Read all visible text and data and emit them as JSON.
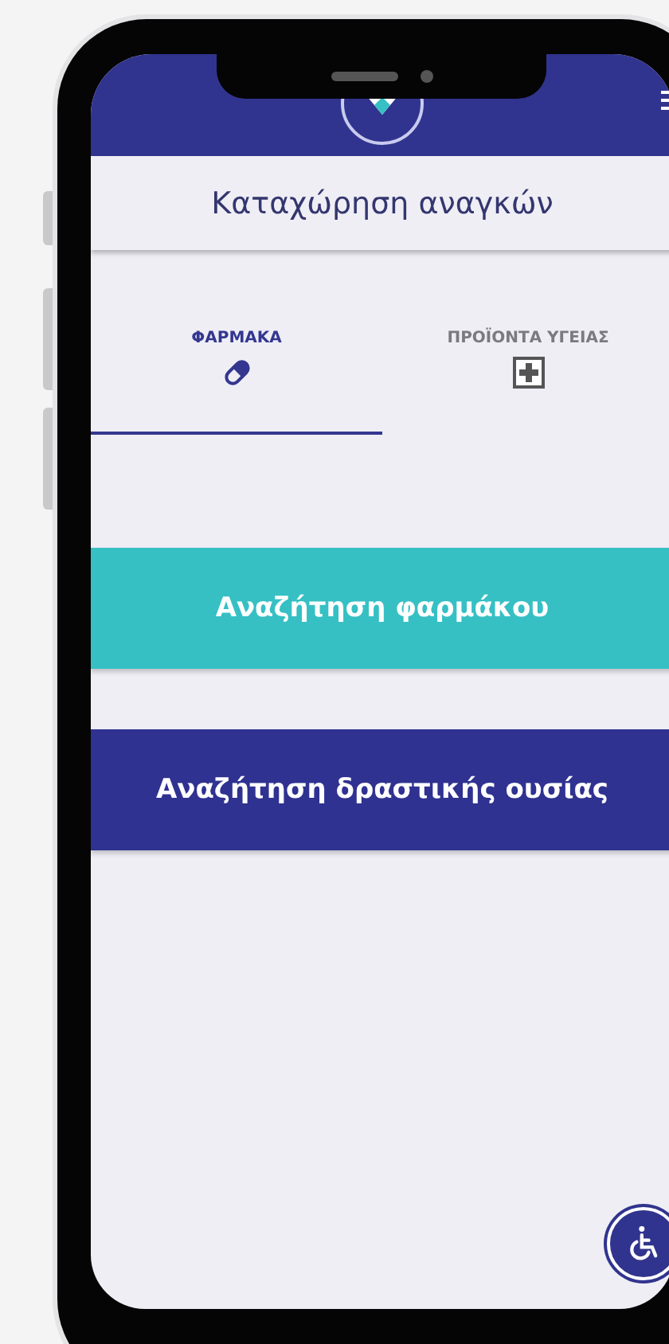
{
  "page_title": "Καταχώρηση αναγκών",
  "tabs": [
    {
      "label": "ΦΑΡΜΑΚΑ",
      "kind": "pill",
      "selected": true
    },
    {
      "label": "ΠΡΟΪΟΝΤΑ ΥΓΕΙΑΣ",
      "kind": "cross",
      "selected": false
    }
  ],
  "actions": [
    {
      "label": "Αναζήτηση φαρμάκου",
      "kind": "teal"
    },
    {
      "label": "Αναζήτηση δραστικής ουσίας",
      "kind": "navy"
    }
  ]
}
